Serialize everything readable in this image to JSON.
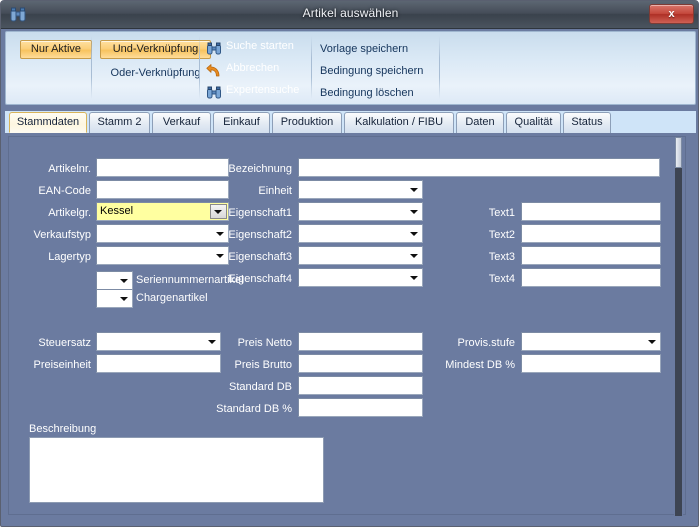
{
  "window": {
    "title": "Artikel auswählen",
    "icon": "binoculars-icon",
    "close_label": "x"
  },
  "ribbon": {
    "toggles": [
      {
        "label": "Nur Aktive",
        "state": "on"
      },
      {
        "label": "Und-Verknüpfung",
        "state": "on"
      }
    ],
    "plain": [
      {
        "label": "Oder-Verknüpfung"
      }
    ],
    "commands": [
      {
        "label": "Suche starten",
        "icon": "binoculars-icon"
      },
      {
        "label": "Abbrechen",
        "icon": "undo-arrow-icon"
      },
      {
        "label": "Expertensuche",
        "icon": "binoculars-icon"
      }
    ],
    "text_commands": [
      {
        "label": "Vorlage speichern"
      },
      {
        "label": "Bedingung speichern"
      },
      {
        "label": "Bedingung löschen"
      }
    ]
  },
  "tabs": [
    {
      "label": "Stammdaten",
      "active": true
    },
    {
      "label": "Stamm 2",
      "active": false
    },
    {
      "label": "Verkauf",
      "active": false
    },
    {
      "label": "Einkauf",
      "active": false
    },
    {
      "label": "Produktion",
      "active": false
    },
    {
      "label": "Kalkulation / FIBU",
      "active": false
    },
    {
      "label": "Daten",
      "active": false
    },
    {
      "label": "Qualität",
      "active": false
    },
    {
      "label": "Status",
      "active": false
    }
  ],
  "form": {
    "col1": [
      {
        "label": "Artikelnr.",
        "value": "",
        "type": "text"
      },
      {
        "label": "EAN-Code",
        "value": "",
        "type": "text"
      },
      {
        "label": "Artikelgr.",
        "value": "Kessel",
        "type": "combo-highlight"
      },
      {
        "label": "Verkaufstyp",
        "value": "",
        "type": "combo"
      },
      {
        "label": "Lagertyp",
        "value": "",
        "type": "combo"
      }
    ],
    "flags": [
      {
        "label": "Seriennummernartikel",
        "value": ""
      },
      {
        "label": "Chargenartikel",
        "value": ""
      }
    ],
    "col2": [
      {
        "label": "Bezeichnung",
        "value": "",
        "type": "text"
      },
      {
        "label": "Einheit",
        "value": "",
        "type": "combo"
      },
      {
        "label": "Eigenschaft1",
        "value": "",
        "type": "combo"
      },
      {
        "label": "Eigenschaft2",
        "value": "",
        "type": "combo"
      },
      {
        "label": "Eigenschaft3",
        "value": "",
        "type": "combo"
      },
      {
        "label": "Eigenschaft4",
        "value": "",
        "type": "combo"
      }
    ],
    "col3": [
      {
        "label": "Text1",
        "value": "",
        "type": "text"
      },
      {
        "label": "Text2",
        "value": "",
        "type": "text"
      },
      {
        "label": "Text3",
        "value": "",
        "type": "text"
      },
      {
        "label": "Text4",
        "value": "",
        "type": "text"
      }
    ],
    "pricing_left": [
      {
        "label": "Steuersatz",
        "value": "",
        "type": "combo"
      },
      {
        "label": "Preiseinheit",
        "value": "",
        "type": "text"
      }
    ],
    "pricing_mid": [
      {
        "label": "Preis Netto",
        "value": "",
        "type": "text"
      },
      {
        "label": "Preis Brutto",
        "value": "",
        "type": "text"
      },
      {
        "label": "Standard DB",
        "value": "",
        "type": "text"
      },
      {
        "label": "Standard DB %",
        "value": "",
        "type": "text"
      }
    ],
    "pricing_right": [
      {
        "label": "Provis.stufe",
        "value": "",
        "type": "combo"
      },
      {
        "label": "Mindest DB %",
        "value": "",
        "type": "text"
      }
    ],
    "description": {
      "label": "Beschreibung",
      "value": ""
    }
  },
  "colors": {
    "window_body": "#6b7ba0",
    "ribbon": "#d9e8f5",
    "toggle_on": "#f7c35f",
    "highlight_field": "#ffffa0",
    "close_button": "#c4483c"
  }
}
